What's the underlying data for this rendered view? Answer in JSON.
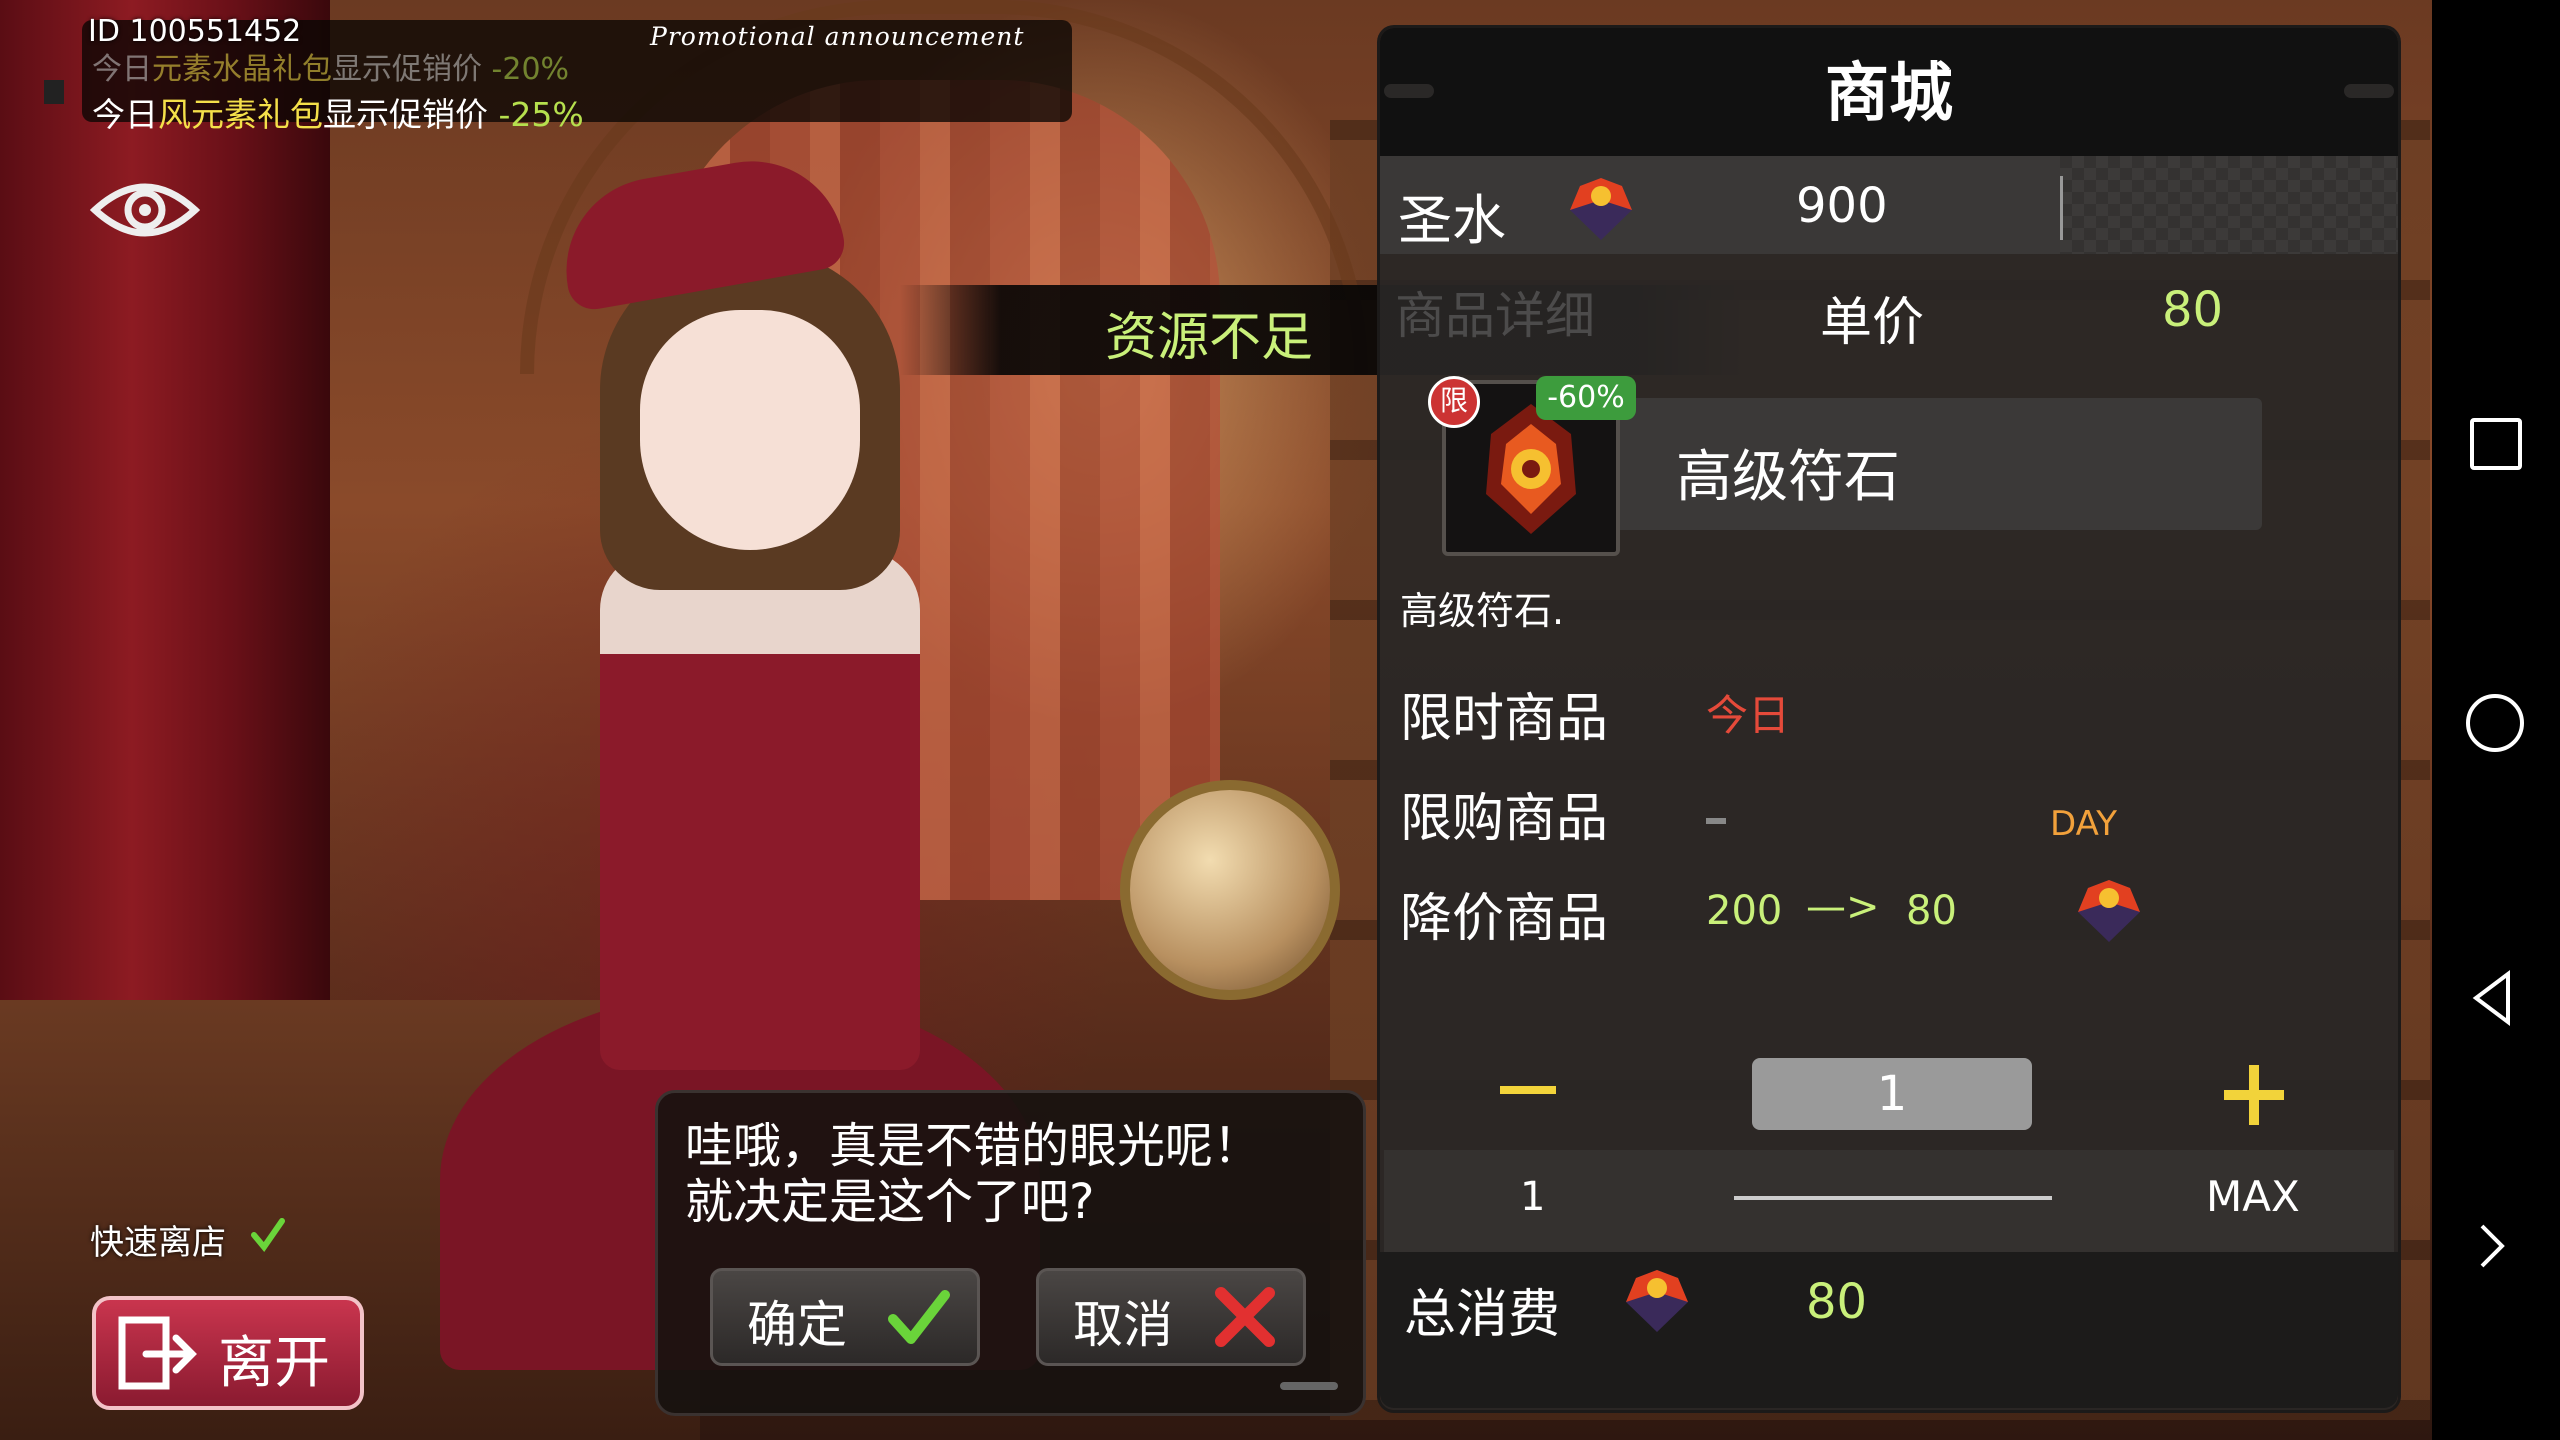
{
  "user_id": "ID 100551452",
  "promo": {
    "title": "Promotional announcement",
    "line1": {
      "prefix": "今日",
      "element": "元素",
      "name": "水晶礼包",
      "suffix": "显示促销价 ",
      "discount": "-20%"
    },
    "line2": {
      "prefix": "今日",
      "element": "风元素礼包",
      "suffix": "显示促销价 ",
      "discount": "-25%"
    }
  },
  "banner": "资源不足",
  "dialog": {
    "line1": "哇哦，真是不错的眼光呢！",
    "line2": "就决定是这个了吧?",
    "confirm": "确定",
    "cancel": "取消"
  },
  "quick_leave": "快速离店",
  "leave": "离开",
  "shop": {
    "title": "商城",
    "currency_label": "圣水",
    "balance": "900",
    "detail_tab": "商品详细",
    "unit_price_label": "单价",
    "unit_price": "80",
    "item": {
      "badge_limit": "限",
      "badge_discount": "-60%",
      "name": "高级符石",
      "description": "高级符石."
    },
    "limited_time_label": "限时商品",
    "limited_time_value": "今日",
    "purchase_limit_label": "限购商品",
    "purchase_limit_period": "DAY",
    "sale_label": "降价商品",
    "old_price": "200",
    "arrow": "—>",
    "new_price": "80",
    "quantity": "1",
    "slider_min": "1",
    "slider_max": "MAX",
    "total_label": "总消费",
    "total": "80"
  },
  "colors": {
    "accent_green": "#c9f07a",
    "warning_red": "#e54a3a",
    "gold": "#f2d33a",
    "leave_button": "#c9354e"
  },
  "icons": [
    "eye-icon",
    "holy-water-gem-icon",
    "checkmark-icon",
    "cross-icon",
    "exit-door-icon",
    "rune-stone-icon",
    "nav-square-icon",
    "nav-circle-icon",
    "nav-back-icon",
    "nav-chevron-icon"
  ]
}
